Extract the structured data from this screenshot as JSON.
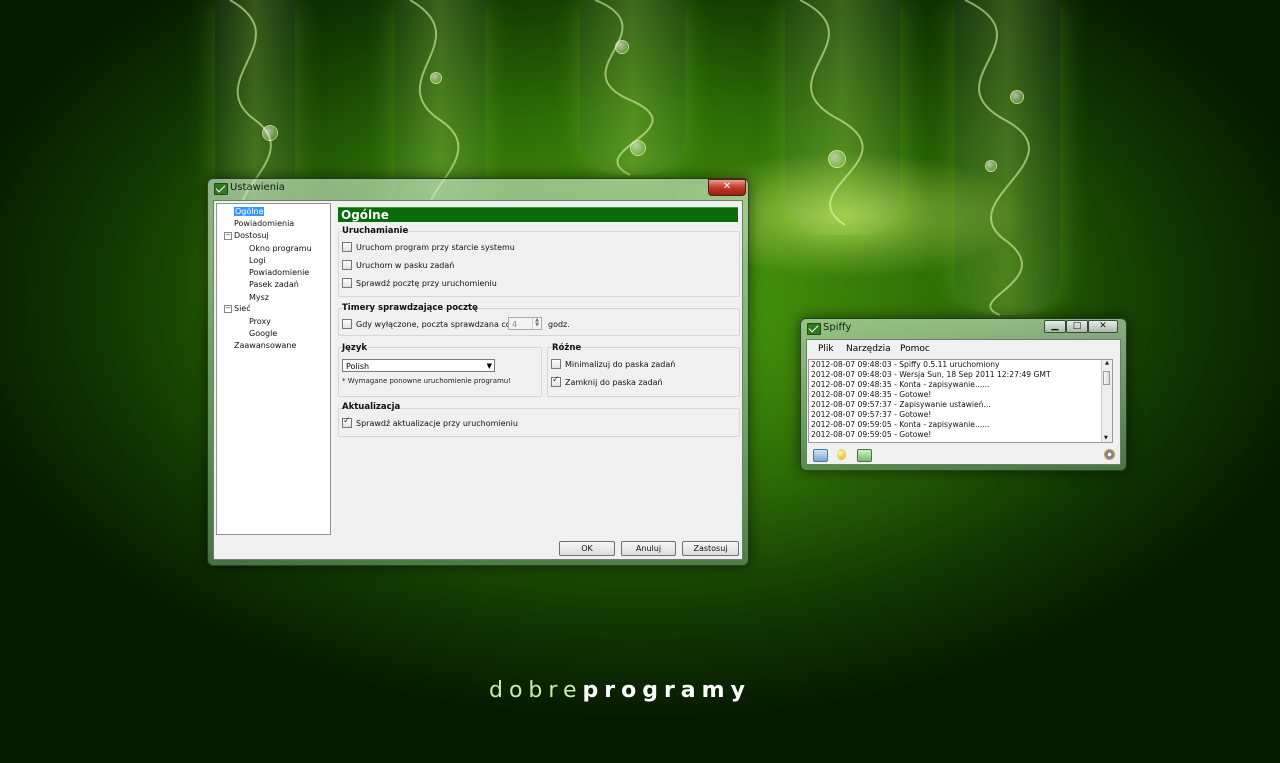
{
  "desktop": {
    "brand_light": "dobre",
    "brand_bold": "programy"
  },
  "settings_window": {
    "title": "Ustawienia",
    "close_glyph": "✕",
    "tree": [
      {
        "label": "Ogólne",
        "selected": true
      },
      {
        "label": "Powiadomienia"
      },
      {
        "label": "Dostosuj"
      },
      {
        "label": "Okno programu"
      },
      {
        "label": "Logi"
      },
      {
        "label": "Powiadomienie"
      },
      {
        "label": "Pasek zadań"
      },
      {
        "label": "Mysz"
      },
      {
        "label": "Sieć"
      },
      {
        "label": "Proxy"
      },
      {
        "label": "Google"
      },
      {
        "label": "Zaawansowane"
      }
    ],
    "header": "Ogólne",
    "startup": {
      "label": "Uruchamianie",
      "options": [
        {
          "label": "Uruchom program przy starcie systemu",
          "checked": false
        },
        {
          "label": "Uruchom w pasku zadań",
          "checked": false
        },
        {
          "label": "Sprawdź pocztę przy uruchomieniu",
          "checked": false
        }
      ]
    },
    "timers": {
      "label": "Timery sprawdzające pocztę",
      "option": {
        "label": "Gdy wyłączone, poczta sprawdzana co",
        "checked": false
      },
      "value": "4",
      "unit": "godz."
    },
    "language": {
      "label": "Język",
      "selected": "Polish",
      "note": "* Wymagane ponowne uruchomienie programu!"
    },
    "misc": {
      "label": "Różne",
      "options": [
        {
          "label": "Minimalizuj do paska zadań",
          "checked": false
        },
        {
          "label": "Zamknij do paska zadań",
          "checked": true
        }
      ]
    },
    "update": {
      "label": "Aktualizacja",
      "option": {
        "label": "Sprawdź aktualizacje przy uruchomieniu",
        "checked": true
      }
    },
    "buttons": {
      "ok": "OK",
      "cancel": "Anuluj",
      "apply": "Zastosuj"
    }
  },
  "spiffy_window": {
    "title": "Spiffy",
    "minimize_glyph": "▁",
    "maximize_glyph": "□",
    "close_glyph": "✕",
    "menu": [
      "Plik",
      "Narzędzia",
      "Pomoc"
    ],
    "log": [
      "2012-08-07 09:48:03 - Spiffy 0.5.11 uruchomiony",
      "2012-08-07 09:48:03 - Wersja Sun, 18 Sep 2011 12:27:49 GMT",
      "2012-08-07 09:48:35 - Konta - zapisywanie......",
      "2012-08-07 09:48:35 - Gotowe!",
      "2012-08-07 09:57:37 - Zapisywanie ustawień...",
      "2012-08-07 09:57:37 - Gotowe!",
      "2012-08-07 09:59:05 - Konta - zapisywanie......",
      "2012-08-07 09:59:05 - Gotowe!"
    ],
    "status_icons": [
      "mail-icon",
      "bulb-icon",
      "mail-check-icon",
      "settings-icon"
    ]
  },
  "colors": {
    "header_green": "#0a6b0a",
    "selection_blue": "#3399ff",
    "close_red": "#c0392b"
  }
}
